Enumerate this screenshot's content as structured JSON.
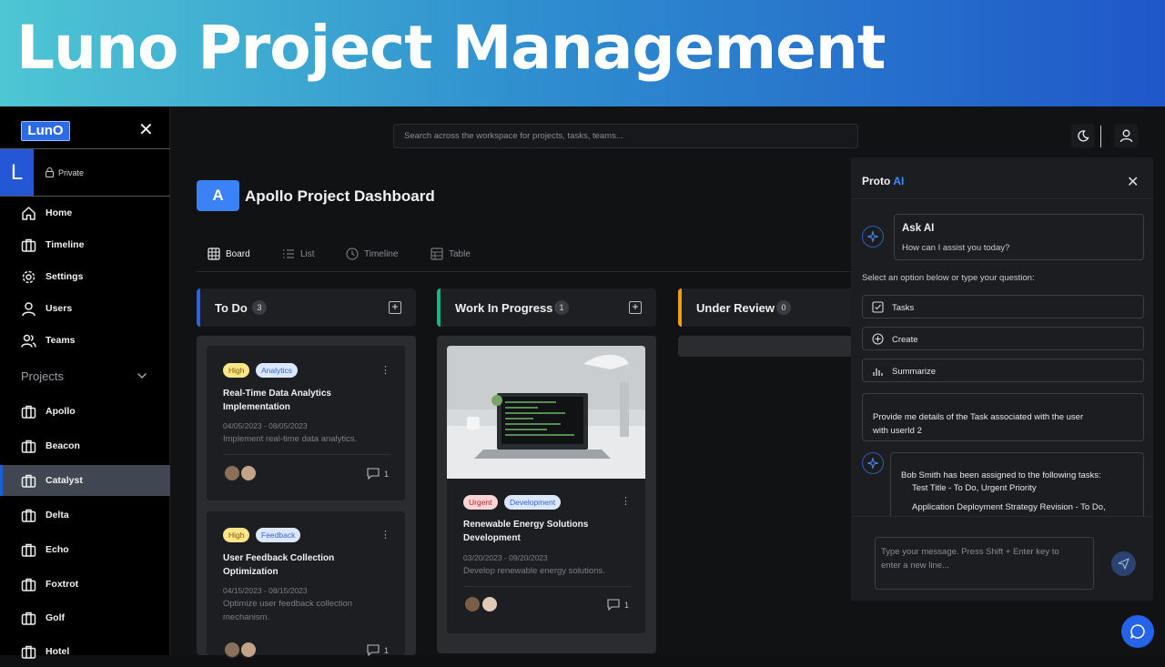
{
  "banner": {
    "title": "Luno Project Management"
  },
  "sidebar": {
    "logo": "LunO",
    "close": "✕",
    "workspace": {
      "initial": "L",
      "visibility": "Private"
    },
    "items": [
      {
        "label": "Home",
        "icon": "home-icon"
      },
      {
        "label": "Timeline",
        "icon": "briefcase-icon"
      },
      {
        "label": "Settings",
        "icon": "gear-icon"
      },
      {
        "label": "Users",
        "icon": "user-icon"
      },
      {
        "label": "Teams",
        "icon": "users-icon"
      }
    ],
    "projects_label": "Projects",
    "projects": [
      {
        "label": "Apollo",
        "active": false
      },
      {
        "label": "Beacon",
        "active": false
      },
      {
        "label": "Catalyst",
        "active": true
      },
      {
        "label": "Delta",
        "active": false
      },
      {
        "label": "Echo",
        "active": false
      },
      {
        "label": "Foxtrot",
        "active": false
      },
      {
        "label": "Golf",
        "active": false
      },
      {
        "label": "Hotel",
        "active": false
      }
    ]
  },
  "topbar": {
    "search_placeholder": "Search across the workspace for projects, tasks, teams..."
  },
  "project": {
    "initial": "A",
    "title": "Apollo Project Dashboard"
  },
  "views": [
    "Board",
    "List",
    "Timeline",
    "Table"
  ],
  "columns": [
    {
      "name": "To Do",
      "count": "3",
      "color": "#2563eb"
    },
    {
      "name": "Work In Progress",
      "count": "1",
      "color": "#10b981"
    },
    {
      "name": "Under Review",
      "count": "0",
      "color": "#f59e0b"
    }
  ],
  "cards": {
    "todo1": {
      "priority": "High",
      "category": "Analytics",
      "title_line1": "Real-Time Data Analytics",
      "title_line2": "Implementation",
      "dates": "04/05/2023 - 08/05/2023",
      "desc": "Implement real-time data analytics.",
      "comments": "1"
    },
    "todo2": {
      "priority": "High",
      "category": "Feedback",
      "title_line1": "User Feedback Collection",
      "title_line2": "Optimization",
      "dates": "04/15/2023 - 08/15/2023",
      "desc_line1": "Optimize user feedback collection",
      "desc_line2": "mechanism.",
      "comments": "1"
    },
    "wip1": {
      "priority": "Urgent",
      "category": "Development",
      "title_line1": "Renewable Energy Solutions",
      "title_line2": "Development",
      "dates": "03/20/2023 - 09/20/2023",
      "desc": "Develop renewable energy solutions.",
      "comments": "1"
    }
  },
  "ai": {
    "title": "Proto",
    "title_accent": "AI",
    "ask_title": "Ask AI",
    "ask_sub": "How can I assist you today?",
    "prompt": "Select an option below or type your question:",
    "options": [
      {
        "label": "Tasks",
        "icon": "checkbox-icon"
      },
      {
        "label": "Create",
        "icon": "plus-circle-icon"
      },
      {
        "label": "Summarize",
        "icon": "bar-chart-icon"
      }
    ],
    "user_msg_line1": "Provide me details of the Task associated with the user",
    "user_msg_line2": "with userId 2",
    "bot_line1": "Bob Smith has been assigned to the following tasks:",
    "bot_line2": "Test Title - To Do, Urgent Priority",
    "bot_line3": "Application Deployment Strategy Revision - To Do,",
    "input_line1": "Type your message. Press Shift + Enter key to",
    "input_line2": "enter a new line..."
  }
}
